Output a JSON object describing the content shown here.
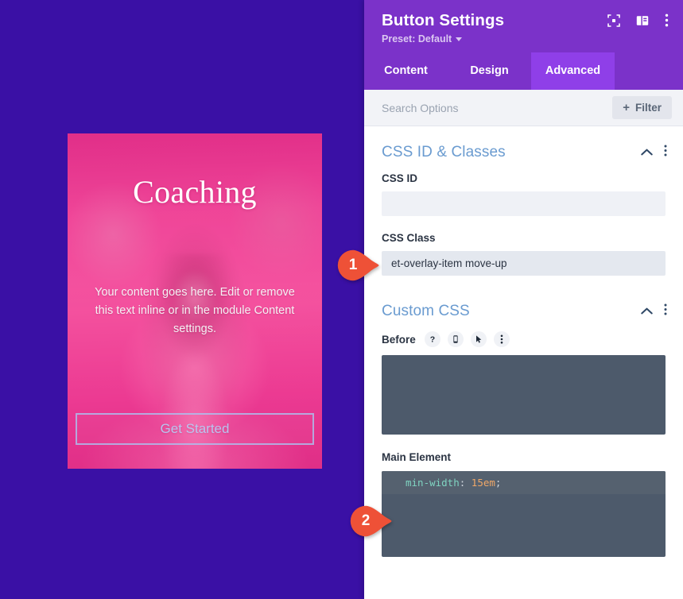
{
  "preview": {
    "card": {
      "title": "Coaching",
      "body": "Your content goes here. Edit or remove this text inline or in the module Content settings.",
      "button_label": "Get Started"
    },
    "background_color": "#3a10a5",
    "card_accent_color": "#ec3f96"
  },
  "panel": {
    "title": "Button Settings",
    "preset_label": "Preset: Default",
    "header_icons": [
      "focus-frame-icon",
      "layout-toggle-icon",
      "more-options-icon"
    ],
    "accent_color": "#7b32c9",
    "active_tab_color": "#8f3fe8",
    "tabs": [
      {
        "label": "Content",
        "active": false
      },
      {
        "label": "Design",
        "active": false
      },
      {
        "label": "Advanced",
        "active": true
      }
    ],
    "search": {
      "placeholder": "Search Options",
      "value": "",
      "filter_label": "Filter"
    },
    "sections": [
      {
        "title": "CSS ID & Classes",
        "collapsed": false,
        "fields": [
          {
            "label": "CSS ID",
            "value": "",
            "placeholder": ""
          },
          {
            "label": "CSS Class",
            "value": "et-overlay-item move-up",
            "placeholder": ""
          }
        ]
      },
      {
        "title": "Custom CSS",
        "collapsed": false,
        "editors": [
          {
            "label": "Before",
            "icons": [
              "help-icon",
              "mobile-icon",
              "hover-cursor-icon",
              "more-options-icon"
            ],
            "code": "",
            "code_property": "",
            "code_value": ""
          },
          {
            "label": "Main Element",
            "icons": [],
            "code": "min-width: 15em;",
            "code_property": "min-width",
            "code_value": "15em"
          }
        ]
      }
    ],
    "section_title_color": "#6a9bd0",
    "editor_background": "#4d5a6b"
  },
  "callouts": [
    {
      "number": "1",
      "target": "css-class-field",
      "color": "#ee5137"
    },
    {
      "number": "2",
      "target": "main-element-editor",
      "color": "#ee5137"
    }
  ]
}
